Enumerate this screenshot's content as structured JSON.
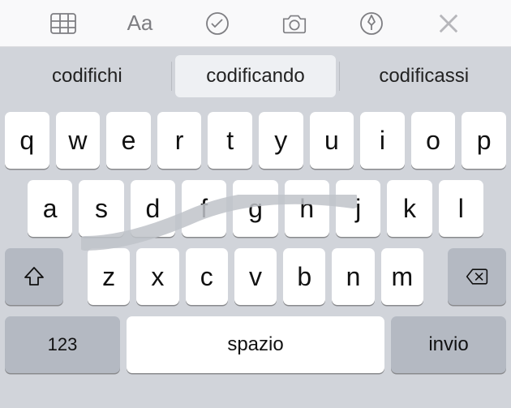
{
  "toolbar": {
    "icons": [
      "table-icon",
      "font-aa-icon",
      "checkmark-circle-icon",
      "camera-icon",
      "markup-pen-icon",
      "close-icon"
    ]
  },
  "suggestions": {
    "left": "codifichi",
    "center": "codificando",
    "right": "codificassi"
  },
  "keyboard": {
    "row1": [
      "q",
      "w",
      "e",
      "r",
      "t",
      "y",
      "u",
      "i",
      "o",
      "p"
    ],
    "row2": [
      "a",
      "s",
      "d",
      "f",
      "g",
      "h",
      "j",
      "k",
      "l"
    ],
    "row3": [
      "z",
      "x",
      "c",
      "v",
      "b",
      "n",
      "m"
    ],
    "symbols_label": "123",
    "space_label": "spazio",
    "return_label": "invio"
  }
}
